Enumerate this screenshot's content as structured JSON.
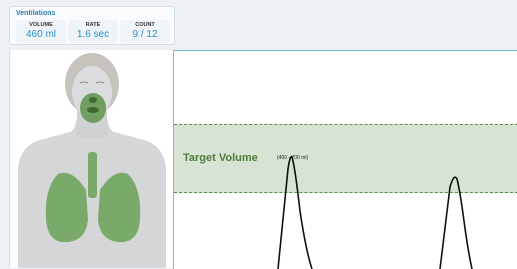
{
  "ventilations": {
    "title": "Ventilations",
    "stats": [
      {
        "label": "VOLUME",
        "value": "460 ml"
      },
      {
        "label": "RATE",
        "value": "1.6 sec"
      },
      {
        "label": "COUNT",
        "value": "9 / 12"
      }
    ]
  },
  "target": {
    "label": "Target Volume",
    "range": "(400 - 700 ml)"
  },
  "colors": {
    "accent_blue": "#2a8fd0",
    "target_green": "#4e7d3c",
    "lung_green": "#7aaa6a"
  }
}
